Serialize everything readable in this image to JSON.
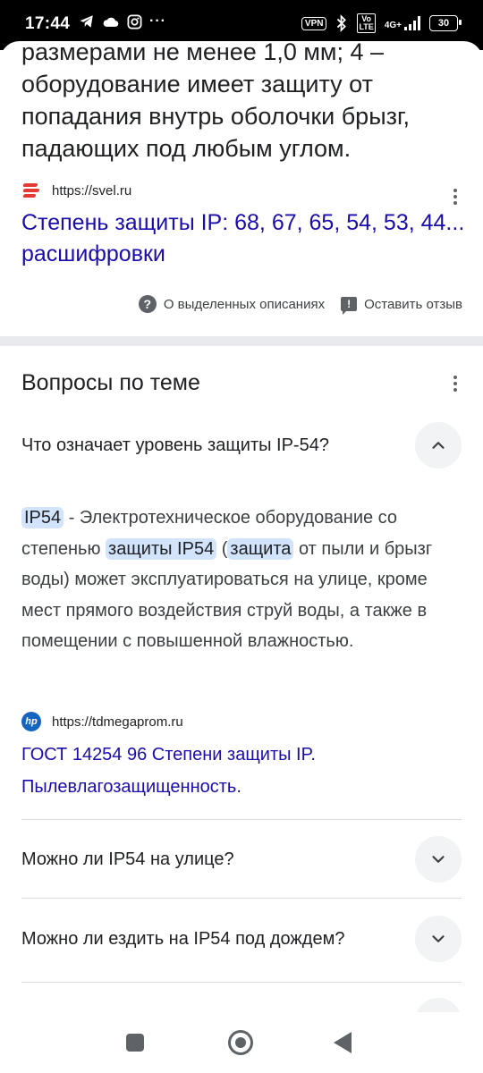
{
  "status_bar": {
    "time": "17:44",
    "left_icons": [
      "telegram-icon",
      "cloud-icon",
      "instagram-icon",
      "more-icon"
    ],
    "vpn": "VPN",
    "bluetooth": "bluetooth-icon",
    "volte": "Vo\nLTE",
    "network": "4G+",
    "battery": "30"
  },
  "prev_result": {
    "snippet": "размерами не менее 1,0 мм; 4 – оборудование имеет защиту от попадания внутрь оболочки брызг, падающих под любым углом.",
    "source_url": "https://svel.ru",
    "title": "Степень защиты IP: 68, 67, 65, 54, 53, 44... расшифровки"
  },
  "feedback": {
    "about_label": "О выделенных описаниях",
    "feedback_label": "Оставить отзыв"
  },
  "related": {
    "title": "Вопросы по теме",
    "questions": [
      "Что означает уровень защиты IP-54?",
      "Можно ли IP54 на улице?",
      "Можно ли ездить на IP54 под дождем?"
    ],
    "answer": {
      "term": "IP54",
      "part1": " - Электротехническое оборудование со степенью ",
      "hl2": "защиты IP54",
      "part2": " (",
      "hl3": "защита",
      "part3": " от пыли и брызг воды) может эксплуатироваться на улице, кроме мест прямого воздействия струй воды, а также в помещении с повышенной влажностью.",
      "source_url": "https://tdmegaprom.ru",
      "link_title": "ГОСТ 14254 96 Степени защиты IP. Пылевлагозащищенность."
    }
  },
  "colors": {
    "link": "#1a0dab",
    "highlight": "#d2e3fc",
    "divider": "#e8eaed"
  }
}
